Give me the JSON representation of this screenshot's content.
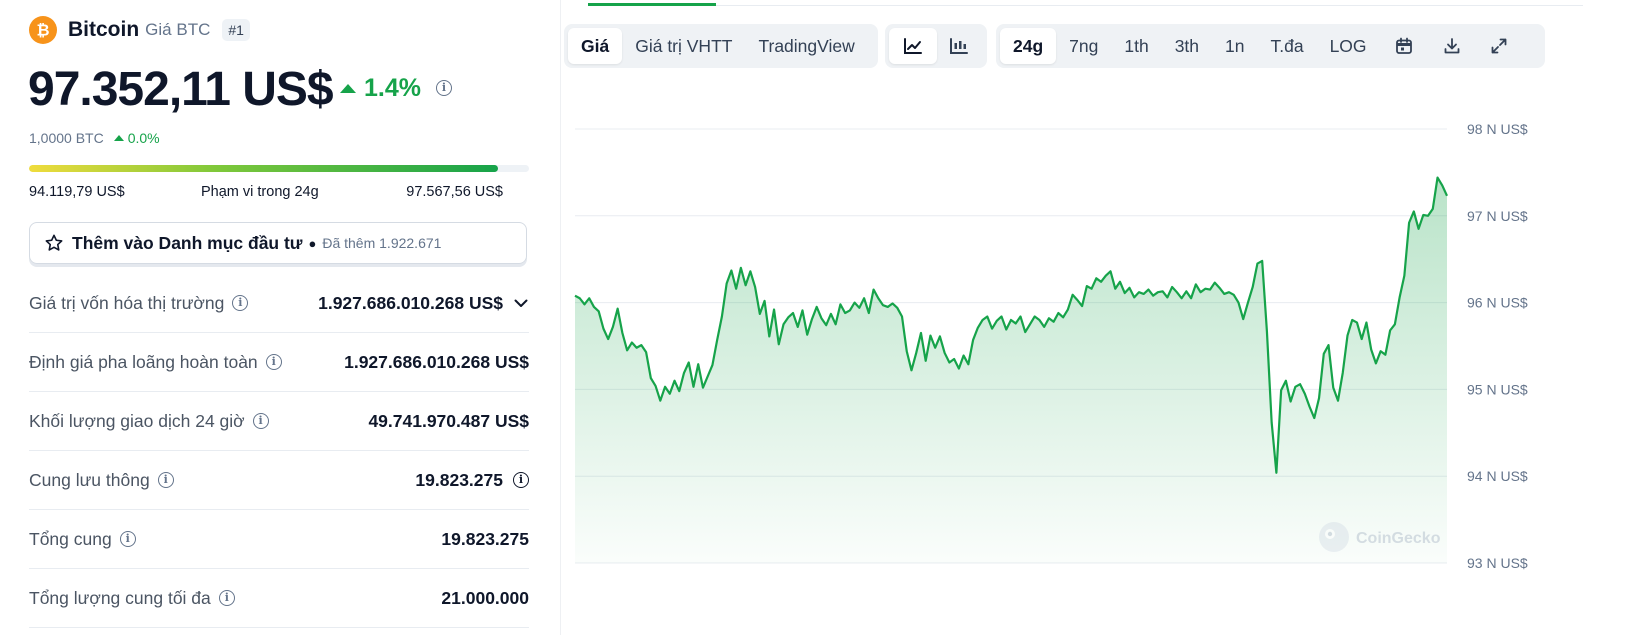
{
  "coin": {
    "name": "Bitcoin",
    "symbol_label": "Giá BTC",
    "rank": "#1",
    "price": "97.352,11 US$",
    "change_pct": "1.4%",
    "btc_amount": "1,0000 BTC",
    "btc_change": "0.0%"
  },
  "range": {
    "low": "94.119,79 US$",
    "label": "Phạm vi trong 24g",
    "high": "97.567,56 US$",
    "position_fraction": 0.9376
  },
  "portfolio": {
    "label": "Thêm vào Danh mục đầu tư",
    "added": "Đã thêm 1.922.671"
  },
  "stats": [
    {
      "label": "Giá trị vốn hóa thị trường",
      "value": "1.927.686.010.268 US$",
      "extra": "chevron-down"
    },
    {
      "label": "Định giá pha loãng hoàn toàn",
      "value": "1.927.686.010.268 US$",
      "extra": ""
    },
    {
      "label": "Khối lượng giao dịch 24 giờ",
      "value": "49.741.970.487 US$",
      "extra": ""
    },
    {
      "label": "Cung lưu thông",
      "value": "19.823.275",
      "extra": "info"
    },
    {
      "label": "Tổng cung",
      "value": "19.823.275",
      "extra": ""
    },
    {
      "label": "Tổng lượng cung tối đa",
      "value": "21.000.000",
      "extra": ""
    }
  ],
  "toolbar": {
    "view_tabs": [
      "Giá",
      "Giá trị VHTT",
      "TradingView"
    ],
    "active_view": "Giá",
    "chart_types": [
      "line-chart-icon",
      "candlestick-icon"
    ],
    "ranges": [
      "24g",
      "7ng",
      "1th",
      "3th",
      "1n",
      "T.đa",
      "LOG"
    ],
    "active_range": "24g",
    "actions": [
      "calendar-icon",
      "download-icon",
      "expand-icon"
    ]
  },
  "chart_data": {
    "type": "area",
    "y_ticks": [
      {
        "value": 98000,
        "label": "98 N US$"
      },
      {
        "value": 97000,
        "label": "97 N US$"
      },
      {
        "value": 96000,
        "label": "96 N US$"
      },
      {
        "value": 95000,
        "label": "95 N US$"
      },
      {
        "value": 94000,
        "label": "94 N US$"
      },
      {
        "value": 93000,
        "label": "93 N US$"
      }
    ],
    "ylim": [
      93000,
      98000
    ],
    "line_color": "#16a34a",
    "watermark": "CoinGecko",
    "values": [
      96080,
      96050,
      95980,
      96050,
      95950,
      95900,
      95700,
      95580,
      95720,
      95930,
      95650,
      95450,
      95540,
      95480,
      95510,
      95430,
      95130,
      95040,
      94870,
      95030,
      94950,
      95100,
      94980,
      95190,
      95310,
      95030,
      95290,
      95020,
      95150,
      95280,
      95570,
      95840,
      96220,
      96370,
      96160,
      96400,
      96200,
      96360,
      96180,
      95870,
      96020,
      95610,
      95920,
      95520,
      95750,
      95830,
      95880,
      95720,
      95910,
      95630,
      95810,
      95950,
      95820,
      95740,
      95870,
      95750,
      95980,
      95880,
      95910,
      96000,
      95940,
      96050,
      95880,
      96150,
      96050,
      95970,
      95950,
      95990,
      95940,
      95840,
      95440,
      95220,
      95420,
      95650,
      95330,
      95620,
      95480,
      95610,
      95420,
      95310,
      95350,
      95240,
      95390,
      95290,
      95570,
      95710,
      95800,
      95840,
      95700,
      95790,
      95840,
      95690,
      95800,
      95760,
      95840,
      95660,
      95750,
      95840,
      95800,
      95720,
      95820,
      95780,
      95880,
      95830,
      95920,
      96090,
      96030,
      95960,
      96190,
      96160,
      96280,
      96240,
      96310,
      96360,
      96160,
      96240,
      96110,
      96170,
      96060,
      96120,
      96100,
      96150,
      96080,
      96120,
      96130,
      96060,
      96180,
      96120,
      96050,
      96130,
      96050,
      96210,
      96120,
      96160,
      96150,
      96230,
      96170,
      96100,
      96120,
      96090,
      96000,
      95810,
      96000,
      96180,
      96450,
      96480,
      95670,
      94620,
      94040,
      94990,
      95100,
      94860,
      95030,
      95060,
      94950,
      94800,
      94670,
      94900,
      95410,
      95510,
      95020,
      94870,
      95190,
      95620,
      95800,
      95770,
      95580,
      95770,
      95460,
      95300,
      95440,
      95400,
      95680,
      95750,
      96060,
      96310,
      96920,
      97050,
      96850,
      97010,
      97000,
      97080,
      97440,
      97350,
      97230
    ]
  }
}
